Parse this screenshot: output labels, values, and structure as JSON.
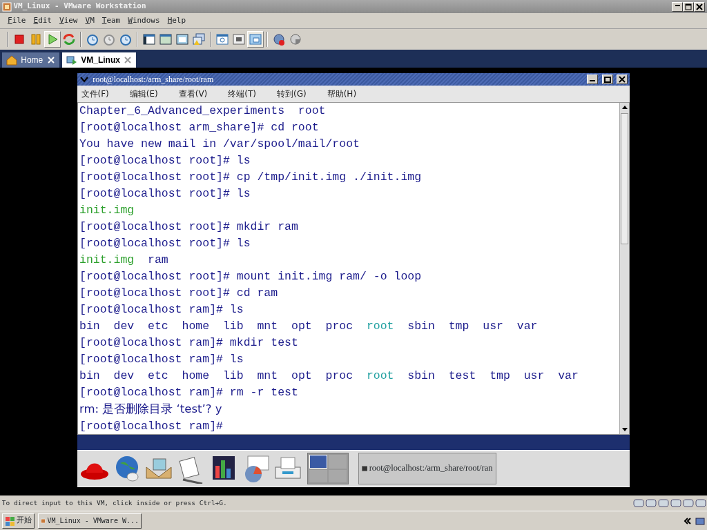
{
  "window": {
    "title": "VM_Linux - VMware Workstation"
  },
  "menu": [
    "File",
    "Edit",
    "View",
    "VM",
    "Team",
    "Windows",
    "Help"
  ],
  "toolbar": [
    [
      {
        "selected": false
      },
      {
        "selected": false
      },
      {
        "selected": true
      },
      {
        "selected": false
      }
    ],
    [
      {
        "selected": false
      },
      {
        "selected": false
      },
      {
        "selected": false
      }
    ],
    [
      {
        "selected": false
      },
      {
        "selected": false
      },
      {
        "selected": false
      },
      {
        "selected": false
      }
    ],
    [
      {
        "selected": false
      },
      {
        "selected": false
      },
      {
        "selected": true
      }
    ],
    [
      {
        "selected": false
      },
      {
        "selected": false
      }
    ]
  ],
  "tabs": [
    {
      "label": "Home",
      "selected": false
    },
    {
      "label": "VM_Linux",
      "selected": true
    }
  ],
  "guest": {
    "title": "root@localhost:/arm_share/root/ram",
    "menu": [
      "文件(F)",
      "编辑(E)",
      "查看(V)",
      "终端(T)",
      "转到(G)",
      "帮助(H)"
    ],
    "lines": [
      {
        "kind": "listing",
        "items": [
          {
            "text": "Chapter_6_Advanced_experiments",
            "color": "#1c1c8c"
          },
          {
            "text": "root",
            "color": "#1c1c8c"
          }
        ]
      },
      {
        "kind": "plain",
        "text": "[root@localhost arm_share]# cd root"
      },
      {
        "kind": "plain",
        "text": "You have new mail in /var/spool/mail/root"
      },
      {
        "kind": "plain",
        "text": "[root@localhost root]# ls"
      },
      {
        "kind": "plain",
        "text": "[root@localhost root]# cp /tmp/init.img ./init.img"
      },
      {
        "kind": "plain",
        "text": "[root@localhost root]# ls"
      },
      {
        "kind": "listing",
        "items": [
          {
            "text": "init.img",
            "color": "#2ca02c"
          }
        ]
      },
      {
        "kind": "plain",
        "text": "[root@localhost root]# mkdir ram"
      },
      {
        "kind": "plain",
        "text": "[root@localhost root]# ls"
      },
      {
        "kind": "listing",
        "items": [
          {
            "text": "init.img",
            "color": "#2ca02c"
          },
          {
            "text": "ram",
            "color": "#1c1c8c"
          }
        ]
      },
      {
        "kind": "plain",
        "text": "[root@localhost root]# mount init.img ram/ -o loop"
      },
      {
        "kind": "plain",
        "text": "[root@localhost root]# cd ram"
      },
      {
        "kind": "plain",
        "text": "[root@localhost ram]# ls"
      },
      {
        "kind": "listing",
        "items": [
          {
            "text": "bin",
            "color": "#1c1c8c"
          },
          {
            "text": "dev",
            "color": "#1c1c8c"
          },
          {
            "text": "etc",
            "color": "#1c1c8c"
          },
          {
            "text": "home",
            "color": "#1c1c8c"
          },
          {
            "text": "lib",
            "color": "#1c1c8c"
          },
          {
            "text": "mnt",
            "color": "#1c1c8c"
          },
          {
            "text": "opt",
            "color": "#1c1c8c"
          },
          {
            "text": "proc",
            "color": "#1c1c8c"
          },
          {
            "text": "root",
            "color": "#20a0a0"
          },
          {
            "text": "sbin",
            "color": "#1c1c8c"
          },
          {
            "text": "tmp",
            "color": "#1c1c8c"
          },
          {
            "text": "usr",
            "color": "#1c1c8c"
          },
          {
            "text": "var",
            "color": "#1c1c8c"
          }
        ]
      },
      {
        "kind": "plain",
        "text": "[root@localhost ram]# mkdir test"
      },
      {
        "kind": "plain",
        "text": "[root@localhost ram]# ls"
      },
      {
        "kind": "listing",
        "items": [
          {
            "text": "bin",
            "color": "#1c1c8c"
          },
          {
            "text": "dev",
            "color": "#1c1c8c"
          },
          {
            "text": "etc",
            "color": "#1c1c8c"
          },
          {
            "text": "home",
            "color": "#1c1c8c"
          },
          {
            "text": "lib",
            "color": "#1c1c8c"
          },
          {
            "text": "mnt",
            "color": "#1c1c8c"
          },
          {
            "text": "opt",
            "color": "#1c1c8c"
          },
          {
            "text": "proc",
            "color": "#1c1c8c"
          },
          {
            "text": "root",
            "color": "#20a0a0"
          },
          {
            "text": "sbin",
            "color": "#1c1c8c"
          },
          {
            "text": "test",
            "color": "#1c1c8c"
          },
          {
            "text": "tmp",
            "color": "#1c1c8c"
          },
          {
            "text": "usr",
            "color": "#1c1c8c"
          },
          {
            "text": "var",
            "color": "#1c1c8c"
          }
        ]
      },
      {
        "kind": "plain",
        "text": "[root@localhost ram]# rm -r test"
      },
      {
        "kind": "plain",
        "text": "rm: 是否删除目录 ‘test’? y"
      },
      {
        "kind": "plain",
        "text": "[root@localhost ram]#"
      }
    ],
    "workspaces": [
      {
        "selected": true
      },
      {
        "selected": false
      },
      {
        "selected": false
      },
      {
        "selected": false
      }
    ],
    "task": "root@localhost:/arm_share/root/ran"
  },
  "status_bar": {
    "text": "To direct input to this VM, click inside or press Ctrl+G."
  },
  "taskbar": {
    "start": "开始",
    "tasks": [
      "VM_Linux - VMware W..."
    ]
  }
}
